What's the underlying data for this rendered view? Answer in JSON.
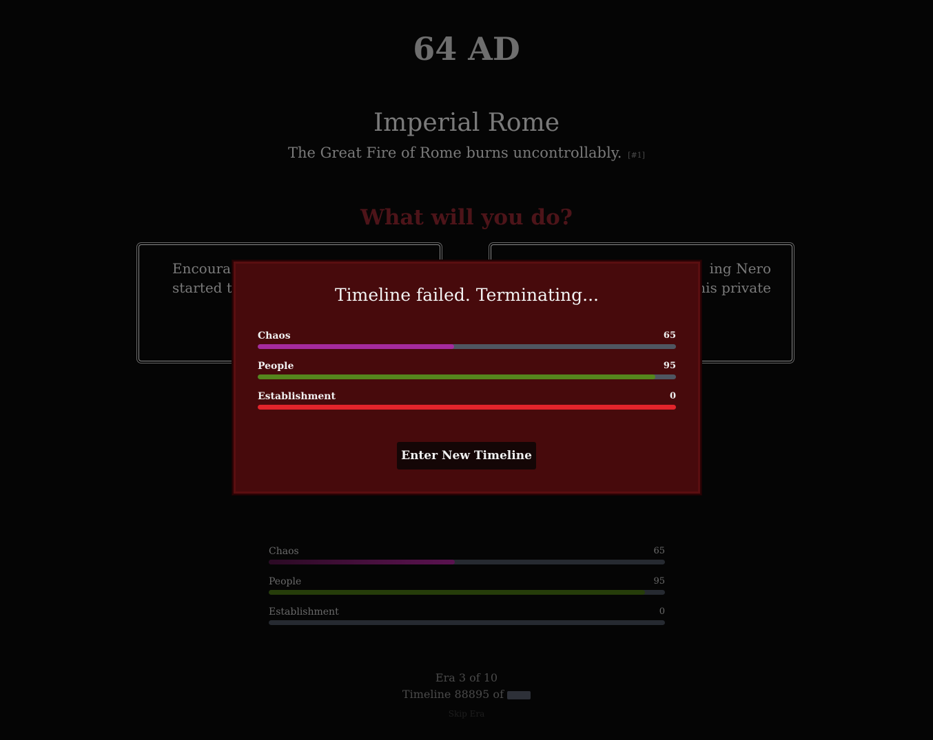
{
  "header": {
    "year": "64 AD",
    "place": "Imperial Rome",
    "event": "The Great Fire of Rome burns uncontrollably.",
    "event_ref": "[#1]",
    "prompt": "What will you do?"
  },
  "choices": [
    {
      "visible_text": "Encoura\nstarted t"
    },
    {
      "visible_text": "ing Nero\nhis private"
    }
  ],
  "stats": [
    {
      "label": "Chaos",
      "value": 65,
      "fill_fraction": 0.47
    },
    {
      "label": "People",
      "value": 95,
      "fill_fraction": 0.95
    },
    {
      "label": "Establishment",
      "value": 0,
      "fill_fraction": 0.0
    }
  ],
  "modal": {
    "title": "Timeline failed. Terminating...",
    "button_label": "Enter New Timeline"
  },
  "footer": {
    "era": "Era 3 of 10",
    "timeline_prefix": "Timeline 88895 of",
    "skip": "Skip Era"
  },
  "colors": {
    "chaos": "#a52b9e",
    "people": "#55861d",
    "establishment": "#e3242b",
    "modal_bg": "#470a0c"
  }
}
